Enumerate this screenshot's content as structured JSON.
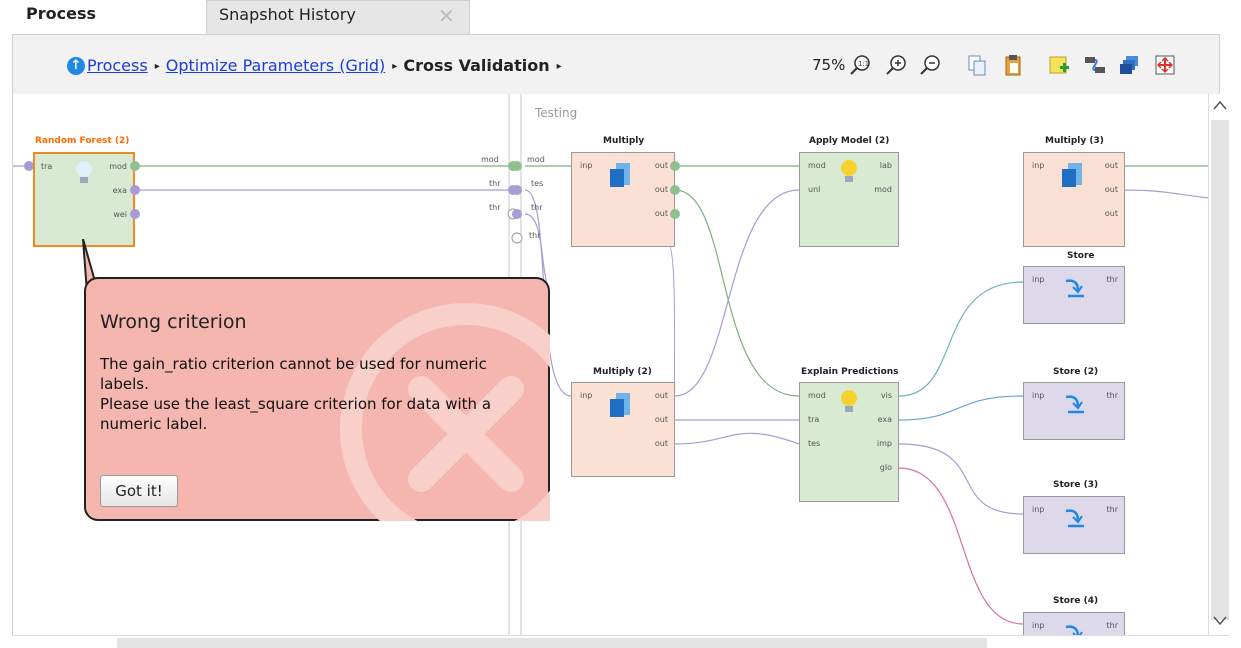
{
  "tabs": {
    "active": "Process",
    "inactive": "Snapshot History",
    "close_glyph": "✕"
  },
  "breadcrumb": {
    "items": [
      "Process",
      "Optimize Parameters (Grid)",
      "Cross Validation"
    ],
    "separator": "▸"
  },
  "toolbar": {
    "zoom": "75%",
    "icons": [
      "zoom-reset-icon",
      "zoom-in-icon",
      "zoom-out-icon",
      "copy-icon",
      "paste-icon",
      "add-note-icon",
      "auto-wire-icon",
      "arrange-icon",
      "fit-icon"
    ]
  },
  "canvas": {
    "testing_label": "Testing",
    "left_ports": [
      "mod",
      "thr",
      "thr"
    ],
    "right_ports": [
      "mod",
      "tes",
      "thr",
      "thr"
    ]
  },
  "operators": {
    "random_forest": {
      "title": "Random Forest (2)",
      "in": [
        "tra"
      ],
      "out": [
        "mod",
        "exa",
        "wei"
      ]
    },
    "multiply": {
      "title": "Multiply",
      "in": [
        "inp"
      ],
      "out": [
        "out",
        "out",
        "out"
      ]
    },
    "apply_model": {
      "title": "Apply Model (2)",
      "in": [
        "mod",
        "unl"
      ],
      "out": [
        "lab",
        "mod"
      ]
    },
    "multiply3": {
      "title": "Multiply (3)",
      "in": [
        "inp"
      ],
      "out": [
        "out",
        "out",
        "out"
      ]
    },
    "store": {
      "title": "Store",
      "in": [
        "inp"
      ],
      "out": [
        "thr"
      ]
    },
    "multiply2": {
      "title": "Multiply (2)",
      "in": [
        "inp"
      ],
      "out": [
        "out",
        "out",
        "out"
      ]
    },
    "explain": {
      "title": "Explain Predictions",
      "in": [
        "mod",
        "tra",
        "tes"
      ],
      "out": [
        "vis",
        "exa",
        "imp",
        "glo"
      ]
    },
    "store2": {
      "title": "Store (2)",
      "in": [
        "inp"
      ],
      "out": [
        "thr"
      ]
    },
    "store3": {
      "title": "Store (3)",
      "in": [
        "inp"
      ],
      "out": [
        "thr"
      ]
    },
    "store4": {
      "title": "Store (4)",
      "in": [
        "inp"
      ],
      "out": [
        "thr"
      ]
    }
  },
  "tooltip": {
    "title": "Wrong criterion",
    "line1": "The gain_ratio criterion cannot be used for numeric labels.",
    "line2": "Please use the least_square criterion for data with a numeric label.",
    "button": "Got it!"
  },
  "colors": {
    "accent": "#1a3de0",
    "learner_fill": "#d9ead3",
    "util_fill": "#fbe1d4",
    "store_fill": "#ddd9ea",
    "tooltip_fill": "#f4b6ae",
    "error_title": "#ff6a00"
  }
}
